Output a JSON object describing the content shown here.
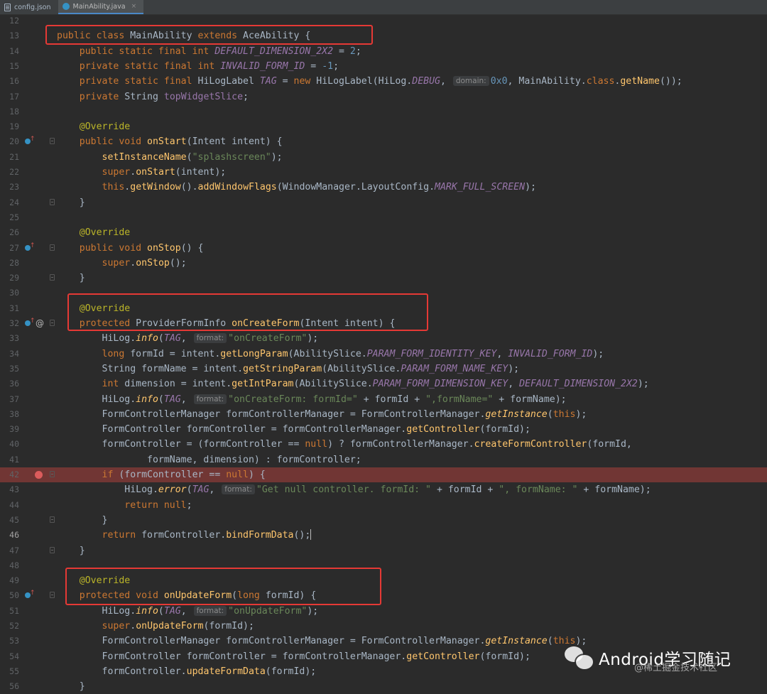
{
  "tabs": [
    {
      "label": "config.json",
      "icon": "json-file-icon",
      "active": false
    },
    {
      "label": "MainAbility.java",
      "icon": "java-class-icon",
      "active": true
    }
  ],
  "hint_labels": {
    "domain": "domain:",
    "format": "format:"
  },
  "lines": [
    {
      "n": "12",
      "t": []
    },
    {
      "n": "13",
      "t": [
        [
          "kw",
          "public class "
        ],
        [
          "cls",
          "MainAbility "
        ],
        [
          "kw",
          "extends "
        ],
        [
          "cls",
          "AceAbility "
        ],
        [
          "txt",
          "{"
        ]
      ]
    },
    {
      "n": "14",
      "t": [
        [
          "txt",
          "    "
        ],
        [
          "kw",
          "public static final int "
        ],
        [
          "cst",
          "DEFAULT_DIMENSION_2X2"
        ],
        [
          "txt",
          " = "
        ],
        [
          "num",
          "2"
        ],
        [
          "txt",
          ";"
        ]
      ]
    },
    {
      "n": "15",
      "t": [
        [
          "txt",
          "    "
        ],
        [
          "kw",
          "private static final int "
        ],
        [
          "cst",
          "INVALID_FORM_ID"
        ],
        [
          "txt",
          " = "
        ],
        [
          "num",
          "-1"
        ],
        [
          "txt",
          ";"
        ]
      ]
    },
    {
      "n": "16",
      "t": [
        [
          "txt",
          "    "
        ],
        [
          "kw",
          "private static final "
        ],
        [
          "cls",
          "HiLogLabel "
        ],
        [
          "cst",
          "TAG"
        ],
        [
          "txt",
          " = "
        ],
        [
          "kw",
          "new "
        ],
        [
          "cls",
          "HiLogLabel(HiLog."
        ],
        [
          "cst",
          "DEBUG"
        ],
        [
          "txt",
          ", "
        ],
        [
          "hint",
          "domain:"
        ],
        [
          "num",
          "0x0"
        ],
        [
          "txt",
          ", MainAbility."
        ],
        [
          "kw",
          "class"
        ],
        [
          "txt",
          "."
        ],
        [
          "call",
          "getName"
        ],
        [
          "txt",
          "());"
        ]
      ]
    },
    {
      "n": "17",
      "t": [
        [
          "txt",
          "    "
        ],
        [
          "kw",
          "private "
        ],
        [
          "cls",
          "String "
        ],
        [
          "fld",
          "topWidgetSlice"
        ],
        [
          "txt",
          ";"
        ]
      ]
    },
    {
      "n": "18",
      "t": []
    },
    {
      "n": "19",
      "t": [
        [
          "txt",
          "    "
        ],
        [
          "ann",
          "@Override"
        ]
      ]
    },
    {
      "n": "20",
      "t": [
        [
          "txt",
          "    "
        ],
        [
          "kw",
          "public void "
        ],
        [
          "mth",
          "onStart"
        ],
        [
          "txt",
          "(Intent intent) {"
        ]
      ],
      "g": "ov"
    },
    {
      "n": "21",
      "t": [
        [
          "txt",
          "        "
        ],
        [
          "call",
          "setInstanceName"
        ],
        [
          "txt",
          "("
        ],
        [
          "str",
          "\"splashscreen\""
        ],
        [
          "txt",
          ");"
        ]
      ]
    },
    {
      "n": "22",
      "t": [
        [
          "txt",
          "        "
        ],
        [
          "kw",
          "super"
        ],
        [
          "txt",
          "."
        ],
        [
          "call",
          "onStart"
        ],
        [
          "txt",
          "(intent);"
        ]
      ]
    },
    {
      "n": "23",
      "t": [
        [
          "txt",
          "        "
        ],
        [
          "kw",
          "this"
        ],
        [
          "txt",
          "."
        ],
        [
          "call",
          "getWindow"
        ],
        [
          "txt",
          "()."
        ],
        [
          "call",
          "addWindowFlags"
        ],
        [
          "txt",
          "(WindowManager.LayoutConfig."
        ],
        [
          "cst",
          "MARK_FULL_SCREEN"
        ],
        [
          "txt",
          ");"
        ]
      ]
    },
    {
      "n": "24",
      "t": [
        [
          "txt",
          "    }"
        ]
      ],
      "f": true
    },
    {
      "n": "25",
      "t": []
    },
    {
      "n": "26",
      "t": [
        [
          "txt",
          "    "
        ],
        [
          "ann",
          "@Override"
        ]
      ]
    },
    {
      "n": "27",
      "t": [
        [
          "txt",
          "    "
        ],
        [
          "kw",
          "public void "
        ],
        [
          "mth",
          "onStop"
        ],
        [
          "txt",
          "() {"
        ]
      ],
      "g": "ov"
    },
    {
      "n": "28",
      "t": [
        [
          "txt",
          "        "
        ],
        [
          "kw",
          "super"
        ],
        [
          "txt",
          "."
        ],
        [
          "call",
          "onStop"
        ],
        [
          "txt",
          "();"
        ]
      ]
    },
    {
      "n": "29",
      "t": [
        [
          "txt",
          "    }"
        ]
      ],
      "f": true
    },
    {
      "n": "30",
      "t": []
    },
    {
      "n": "31",
      "t": [
        [
          "txt",
          "    "
        ],
        [
          "ann",
          "@Override"
        ]
      ]
    },
    {
      "n": "32",
      "t": [
        [
          "txt",
          "    "
        ],
        [
          "kw",
          "protected "
        ],
        [
          "cls",
          "ProviderFormInfo "
        ],
        [
          "mth",
          "onCreateForm"
        ],
        [
          "txt",
          "(Intent intent) {"
        ]
      ],
      "g": "ovat"
    },
    {
      "n": "33",
      "t": [
        [
          "txt",
          "        HiLog."
        ],
        [
          "sfn",
          "info"
        ],
        [
          "txt",
          "("
        ],
        [
          "cst",
          "TAG"
        ],
        [
          "txt",
          ", "
        ],
        [
          "hint",
          "format:"
        ],
        [
          "str",
          "\"onCreateForm\""
        ],
        [
          "txt",
          ");"
        ]
      ]
    },
    {
      "n": "34",
      "t": [
        [
          "txt",
          "        "
        ],
        [
          "kw",
          "long "
        ],
        [
          "txt",
          "formId = intent."
        ],
        [
          "call",
          "getLongParam"
        ],
        [
          "txt",
          "(AbilitySlice."
        ],
        [
          "cst",
          "PARAM_FORM_IDENTITY_KEY"
        ],
        [
          "txt",
          ", "
        ],
        [
          "cst",
          "INVALID_FORM_ID"
        ],
        [
          "txt",
          ");"
        ]
      ]
    },
    {
      "n": "35",
      "t": [
        [
          "txt",
          "        String formName = intent."
        ],
        [
          "call",
          "getStringParam"
        ],
        [
          "txt",
          "(AbilitySlice."
        ],
        [
          "cst",
          "PARAM_FORM_NAME_KEY"
        ],
        [
          "txt",
          ");"
        ]
      ]
    },
    {
      "n": "36",
      "t": [
        [
          "txt",
          "        "
        ],
        [
          "kw",
          "int "
        ],
        [
          "txt",
          "dimension = intent."
        ],
        [
          "call",
          "getIntParam"
        ],
        [
          "txt",
          "(AbilitySlice."
        ],
        [
          "cst",
          "PARAM_FORM_DIMENSION_KEY"
        ],
        [
          "txt",
          ", "
        ],
        [
          "cst",
          "DEFAULT_DIMENSION_2X2"
        ],
        [
          "txt",
          ");"
        ]
      ]
    },
    {
      "n": "37",
      "t": [
        [
          "txt",
          "        HiLog."
        ],
        [
          "sfn",
          "info"
        ],
        [
          "txt",
          "("
        ],
        [
          "cst",
          "TAG"
        ],
        [
          "txt",
          ", "
        ],
        [
          "hint",
          "format:"
        ],
        [
          "str",
          "\"onCreateForm: formId=\""
        ],
        [
          "txt",
          " + formId + "
        ],
        [
          "str",
          "\",formName=\""
        ],
        [
          "txt",
          " + formName);"
        ]
      ]
    },
    {
      "n": "38",
      "t": [
        [
          "txt",
          "        FormControllerManager formControllerManager = FormControllerManager."
        ],
        [
          "sfn",
          "getInstance"
        ],
        [
          "txt",
          "("
        ],
        [
          "kw",
          "this"
        ],
        [
          "txt",
          ");"
        ]
      ]
    },
    {
      "n": "39",
      "t": [
        [
          "txt",
          "        FormController formController = formControllerManager."
        ],
        [
          "call",
          "getController"
        ],
        [
          "txt",
          "(formId);"
        ]
      ]
    },
    {
      "n": "40",
      "t": [
        [
          "txt",
          "        formController = (formController == "
        ],
        [
          "kw",
          "null"
        ],
        [
          "txt",
          ") ? formControllerManager."
        ],
        [
          "call",
          "createFormController"
        ],
        [
          "txt",
          "(formId,"
        ]
      ]
    },
    {
      "n": "41",
      "t": [
        [
          "txt",
          "                formName, dimension) : formController;"
        ]
      ]
    },
    {
      "n": "42",
      "t": [
        [
          "txt",
          "        "
        ],
        [
          "kw",
          "if "
        ],
        [
          "txt",
          "(formController == "
        ],
        [
          "kw",
          "null"
        ],
        [
          "txt",
          ") {"
        ]
      ],
      "bp": true,
      "f": true
    },
    {
      "n": "43",
      "t": [
        [
          "txt",
          "            HiLog."
        ],
        [
          "sfn",
          "error"
        ],
        [
          "txt",
          "("
        ],
        [
          "cst",
          "TAG"
        ],
        [
          "txt",
          ", "
        ],
        [
          "hint",
          "format:"
        ],
        [
          "str",
          "\"Get null controller. formId: \""
        ],
        [
          "txt",
          " + formId + "
        ],
        [
          "str",
          "\", formName: \""
        ],
        [
          "txt",
          " + formName);"
        ]
      ]
    },
    {
      "n": "44",
      "t": [
        [
          "txt",
          "            "
        ],
        [
          "kw",
          "return null"
        ],
        [
          "txt",
          ";"
        ]
      ]
    },
    {
      "n": "45",
      "t": [
        [
          "txt",
          "        }"
        ]
      ],
      "f": true
    },
    {
      "n": "46",
      "t": [
        [
          "txt",
          "        "
        ],
        [
          "kw",
          "return "
        ],
        [
          "txt",
          "formController."
        ],
        [
          "call",
          "bindFormData"
        ],
        [
          "txt",
          "();"
        ],
        [
          "caret",
          ""
        ]
      ],
      "cur": true
    },
    {
      "n": "47",
      "t": [
        [
          "txt",
          "    }"
        ]
      ],
      "f": true
    },
    {
      "n": "48",
      "t": []
    },
    {
      "n": "49",
      "t": [
        [
          "txt",
          "    "
        ],
        [
          "ann",
          "@Override"
        ]
      ]
    },
    {
      "n": "50",
      "t": [
        [
          "txt",
          "    "
        ],
        [
          "kw",
          "protected void "
        ],
        [
          "mth",
          "onUpdateForm"
        ],
        [
          "txt",
          "("
        ],
        [
          "kw",
          "long "
        ],
        [
          "txt",
          "formId) {"
        ]
      ],
      "g": "ov"
    },
    {
      "n": "51",
      "t": [
        [
          "txt",
          "        HiLog."
        ],
        [
          "sfn",
          "info"
        ],
        [
          "txt",
          "("
        ],
        [
          "cst",
          "TAG"
        ],
        [
          "txt",
          ", "
        ],
        [
          "hint",
          "format:"
        ],
        [
          "str",
          "\"onUpdateForm\""
        ],
        [
          "txt",
          ");"
        ]
      ]
    },
    {
      "n": "52",
      "t": [
        [
          "txt",
          "        "
        ],
        [
          "kw",
          "super"
        ],
        [
          "txt",
          "."
        ],
        [
          "call",
          "onUpdateForm"
        ],
        [
          "txt",
          "(formId);"
        ]
      ]
    },
    {
      "n": "53",
      "t": [
        [
          "txt",
          "        FormControllerManager formControllerManager = FormControllerManager."
        ],
        [
          "sfn",
          "getInstance"
        ],
        [
          "txt",
          "("
        ],
        [
          "kw",
          "this"
        ],
        [
          "txt",
          ");"
        ]
      ]
    },
    {
      "n": "54",
      "t": [
        [
          "txt",
          "        FormController formController = formControllerManager."
        ],
        [
          "call",
          "getController"
        ],
        [
          "txt",
          "(formId);"
        ]
      ]
    },
    {
      "n": "55",
      "t": [
        [
          "txt",
          "        formController."
        ],
        [
          "call",
          "updateFormData"
        ],
        [
          "txt",
          "(formId);"
        ]
      ]
    },
    {
      "n": "56",
      "t": [
        [
          "txt",
          "    }"
        ]
      ]
    }
  ],
  "watermark": {
    "title": "Android学习随记",
    "subtitle": "@稀土掘金技术社区",
    "icon": "wechat-icon"
  }
}
